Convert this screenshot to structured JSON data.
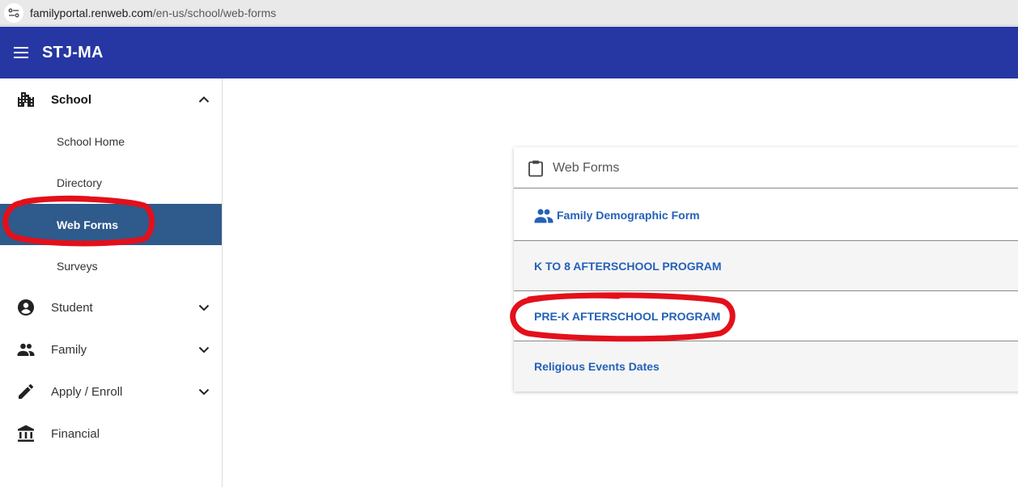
{
  "browser": {
    "url_host": "familyportal.renweb.com",
    "url_path": "/en-us/school/web-forms"
  },
  "header": {
    "menu_icon": "hamburger-menu-icon",
    "title": "STJ-MA",
    "background": "#2637a3"
  },
  "sidebar": {
    "groups": [
      {
        "label": "School",
        "icon": "school-building-icon",
        "expanded": true
      },
      {
        "label": "Student",
        "icon": "account-circle-icon",
        "expanded": false
      },
      {
        "label": "Family",
        "icon": "people-icon",
        "expanded": false
      },
      {
        "label": "Apply / Enroll",
        "icon": "pencil-icon",
        "expanded": false
      },
      {
        "label": "Financial",
        "icon": "bank-icon"
      }
    ],
    "school_items": [
      {
        "label": "School Home"
      },
      {
        "label": "Directory"
      },
      {
        "label": "Web Forms",
        "active": true
      },
      {
        "label": "Surveys"
      }
    ],
    "active_background": "#2e5a8c"
  },
  "card": {
    "title": "Web Forms",
    "title_icon": "clipboard-icon",
    "forms": [
      {
        "label": "Family Demographic Form",
        "icon": "people-icon"
      },
      {
        "label": "K TO 8 AFTERSCHOOL PROGRAM"
      },
      {
        "label": "PRE-K AFTERSCHOOL PROGRAM"
      },
      {
        "label": "Religious Events Dates"
      }
    ],
    "link_color": "#2461b8"
  },
  "annotations": {
    "color": "#e3101b",
    "circled": [
      "Web Forms",
      "PRE-K AFTERSCHOOL PROGRAM"
    ]
  }
}
